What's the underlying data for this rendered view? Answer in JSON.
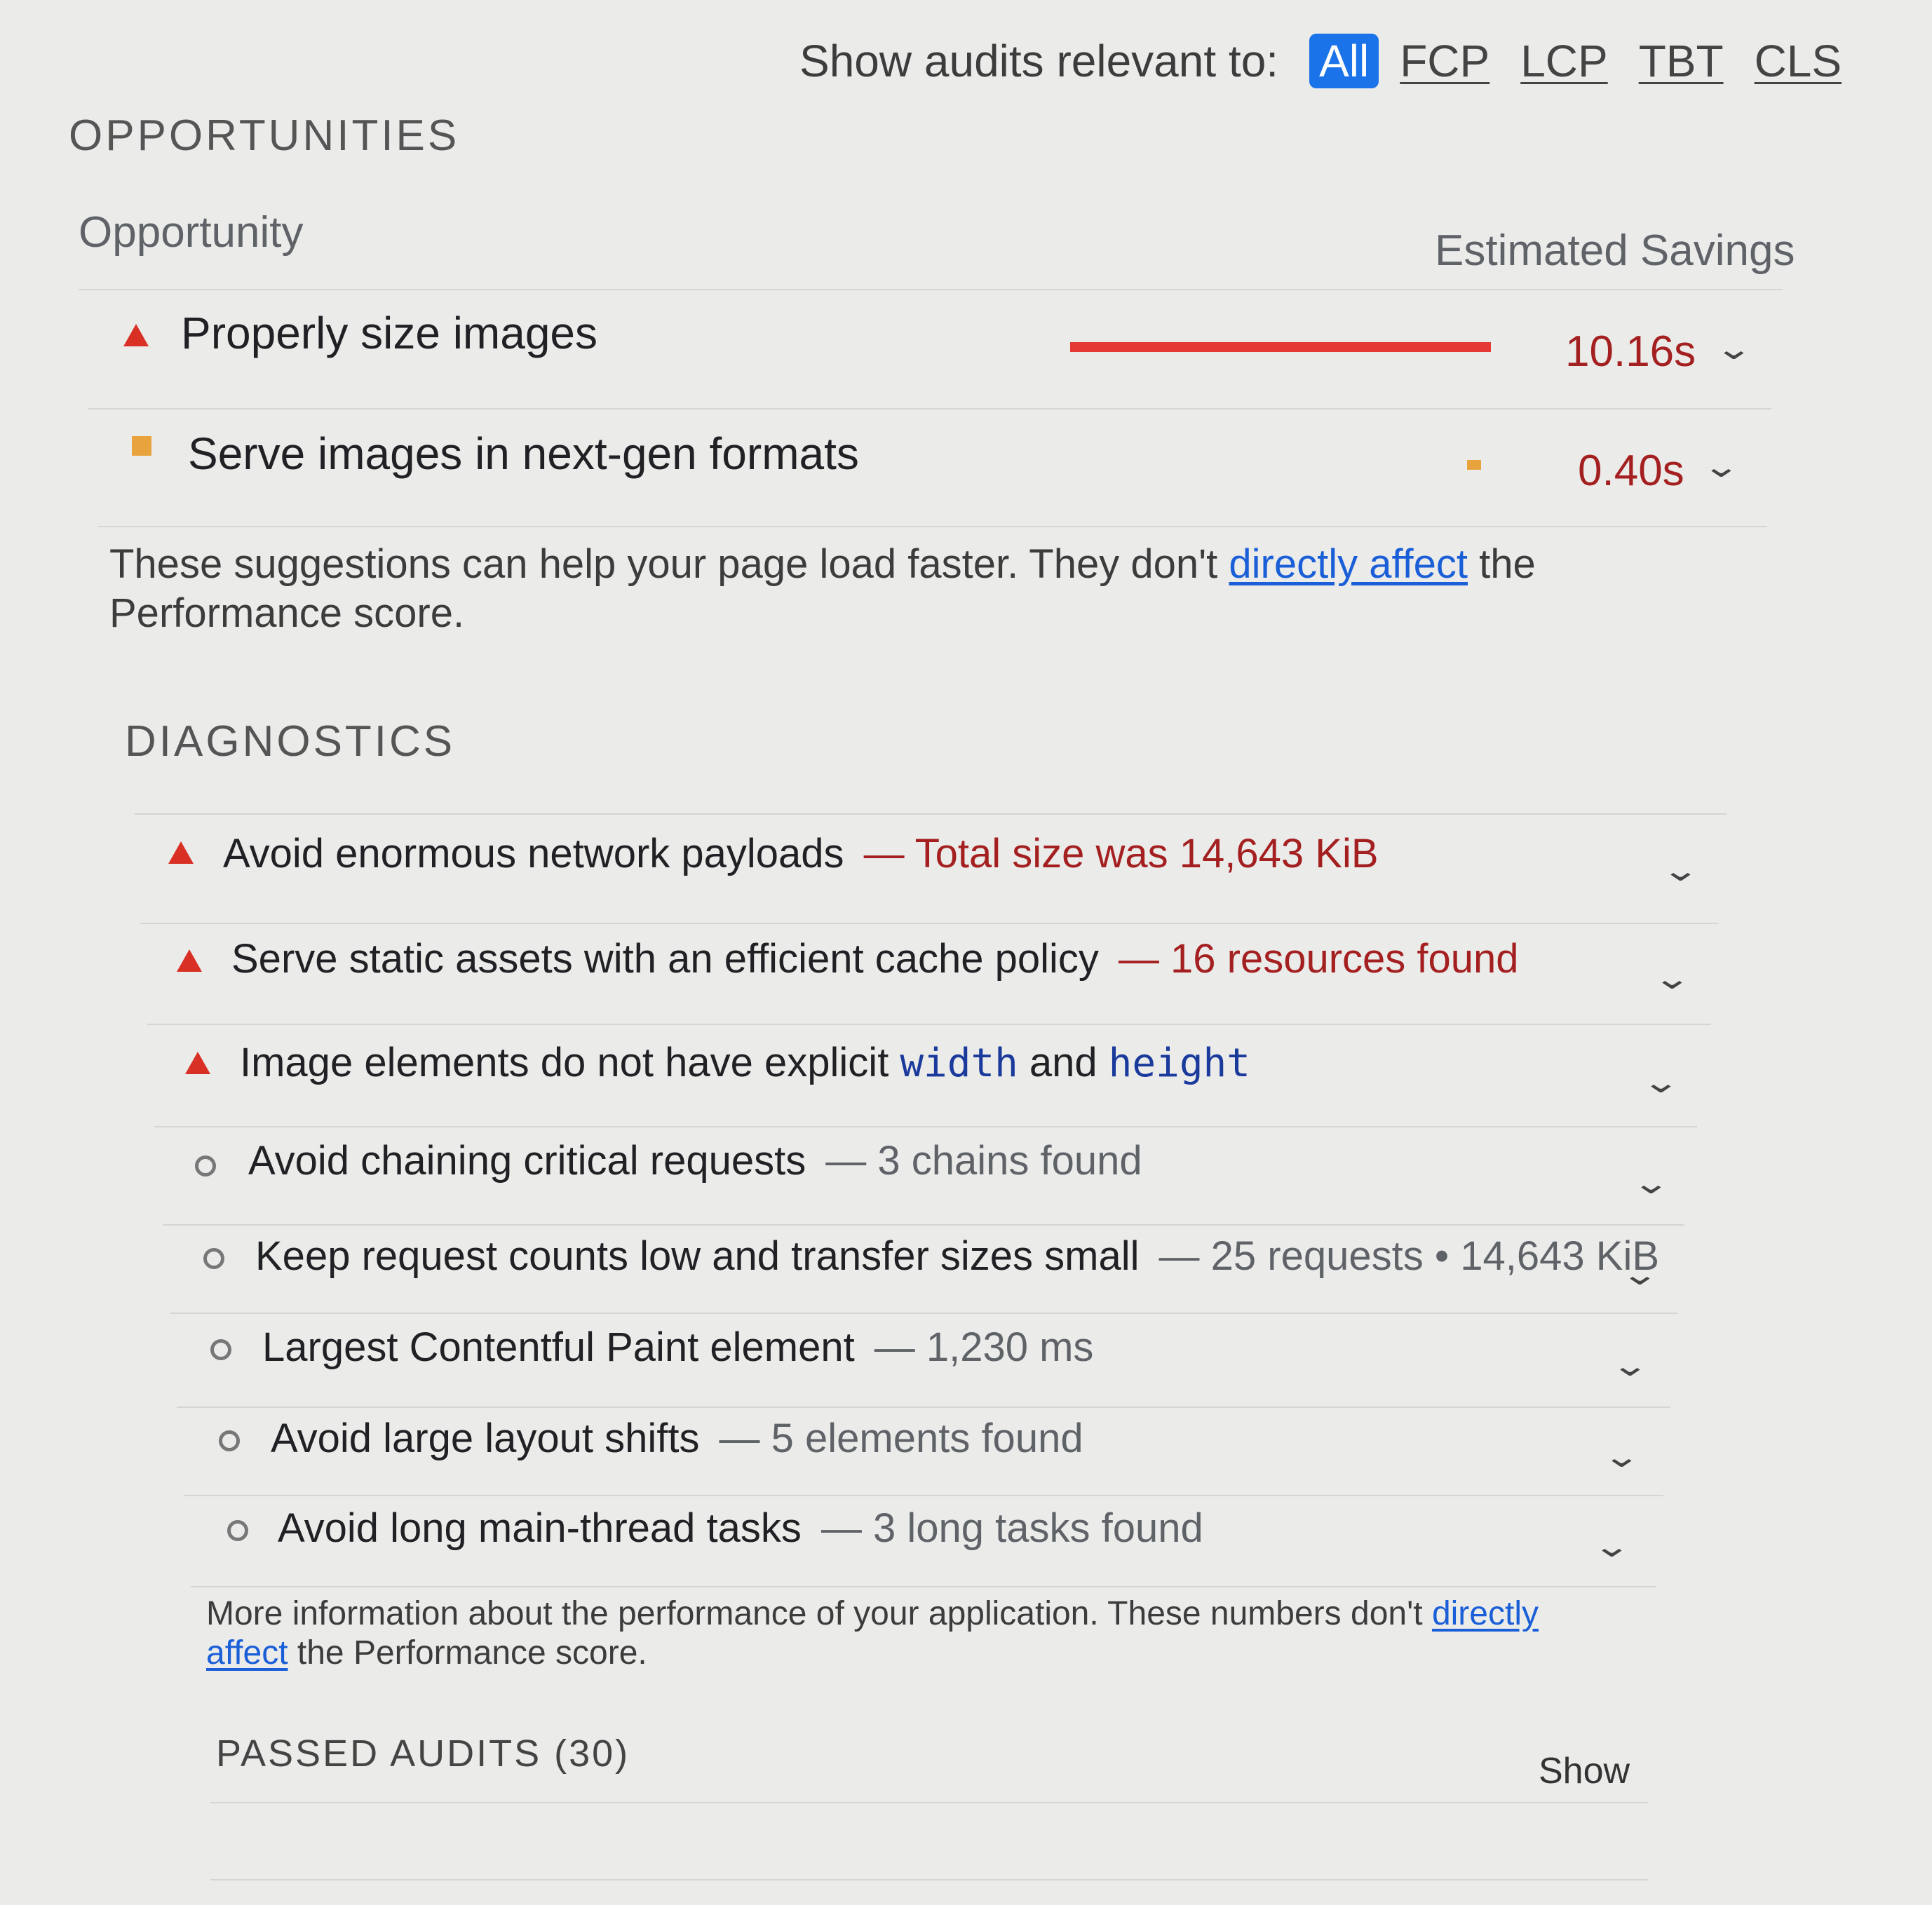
{
  "filter": {
    "label": "Show audits relevant to:",
    "chips": [
      "All",
      "FCP",
      "LCP",
      "TBT",
      "CLS"
    ],
    "selected": "All"
  },
  "opportunities": {
    "section_title": "OPPORTUNITIES",
    "col_opportunity": "Opportunity",
    "col_savings": "Estimated Savings",
    "items": [
      {
        "title": "Properly size images",
        "savings": "10.16s",
        "severity": "fail",
        "bar_fraction": 1.0
      },
      {
        "title": "Serve images in next-gen formats",
        "savings": "0.40s",
        "severity": "average",
        "bar_fraction": 0.04
      }
    ],
    "note_before": "These suggestions can help your page load faster. They don't",
    "note_link": "directly affect",
    "note_after": "the Performance score."
  },
  "diagnostics": {
    "section_title": "DIAGNOSTICS",
    "items": [
      {
        "title": "Avoid enormous network payloads",
        "detail": "— Total size was 14,643 KiB",
        "severity": "fail"
      },
      {
        "title": "Serve static assets with an efficient cache policy",
        "detail": "— 16 resources found",
        "severity": "fail"
      },
      {
        "title_before": "Image elements do not have explicit",
        "code1": "width",
        "title_mid": "and",
        "code2": "height",
        "severity": "fail"
      },
      {
        "title": "Avoid chaining critical requests",
        "detail": "— 3 chains found",
        "severity": "info"
      },
      {
        "title": "Keep request counts low and transfer sizes small",
        "detail": "— 25 requests • 14,643 KiB",
        "severity": "info"
      },
      {
        "title": "Largest Contentful Paint element",
        "detail": "— 1,230 ms",
        "severity": "info"
      },
      {
        "title": "Avoid large layout shifts",
        "detail": "— 5 elements found",
        "severity": "info"
      },
      {
        "title": "Avoid long main-thread tasks",
        "detail": "— 3 long tasks found",
        "severity": "info"
      }
    ],
    "note_before": "More information about the performance of your application. These numbers don't",
    "note_link": "directly affect",
    "note_after": "the Performance score."
  },
  "passed": {
    "title": "PASSED AUDITS (30)",
    "show_label": "Show"
  },
  "colors": {
    "fail": "#d93025",
    "average": "#e8a33d",
    "link": "#1a5fd8",
    "chip_active": "#1a73e8",
    "savings_text": "#a42020"
  }
}
